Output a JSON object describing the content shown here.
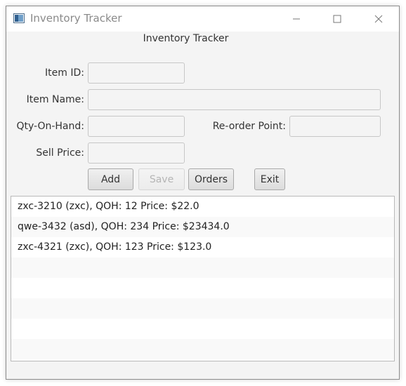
{
  "window": {
    "title": "Inventory Tracker",
    "controls": {
      "minimize_icon": "minimize-icon",
      "maximize_icon": "maximize-icon",
      "close_icon": "close-icon"
    }
  },
  "header": {
    "title": "Inventory Tracker"
  },
  "form": {
    "item_id_label": "Item ID:",
    "item_id_value": "",
    "item_name_label": "Item Name:",
    "item_name_value": "",
    "qty_label": "Qty-On-Hand:",
    "qty_value": "",
    "reorder_label": "Re-order Point:",
    "reorder_value": "",
    "price_label": "Sell Price:",
    "price_value": ""
  },
  "buttons": {
    "add": "Add",
    "save": "Save",
    "save_disabled": true,
    "orders": "Orders",
    "exit": "Exit"
  },
  "list": {
    "items": [
      "zxc-3210 (zxc), QOH: 12 Price: $22.0",
      "qwe-3432 (asd), QOH: 234 Price: $23434.0",
      "zxc-4321 (zxc), QOH: 123 Price: $123.0",
      "",
      "",
      "",
      "",
      "",
      ""
    ]
  },
  "colors": {
    "window_bg": "#f4f4f4",
    "titlebar_bg": "#ffffff",
    "title_text": "#8a8a8a"
  }
}
